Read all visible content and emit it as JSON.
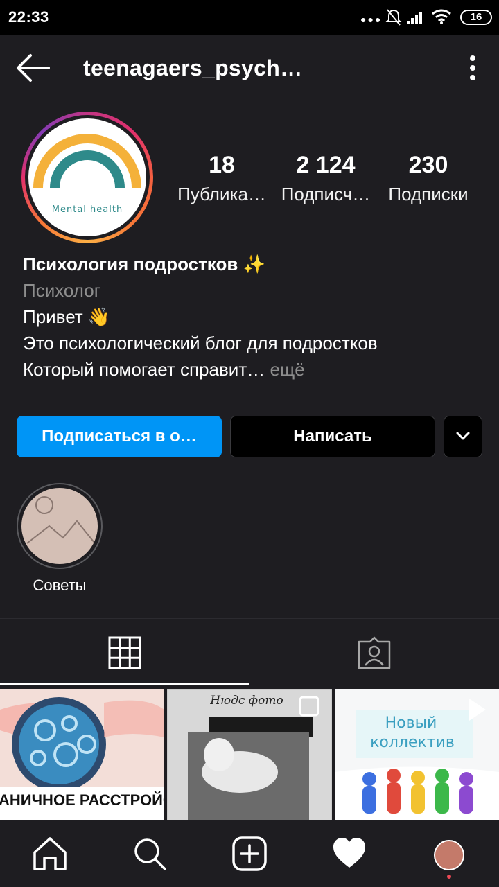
{
  "status_bar": {
    "time": "22:33",
    "battery": "16"
  },
  "header": {
    "username": "teenagaers_psych…"
  },
  "profile": {
    "avatar_text": "Mental health",
    "stats": [
      {
        "number": "18",
        "label": "Публика…"
      },
      {
        "number": "2 124",
        "label": "Подписч…"
      },
      {
        "number": "230",
        "label": "Подписки"
      }
    ],
    "name": "Психология  подростков ✨",
    "category": "Психолог",
    "bio_lines": [
      "Привет 👋",
      "Это психологический блог для подростков",
      "Который помогает справит…"
    ],
    "bio_more": " ещё"
  },
  "actions": {
    "follow_label": "Подписаться в о…",
    "message_label": "Написать"
  },
  "highlights": [
    {
      "label": "Советы"
    }
  ],
  "grid_posts": [
    {
      "caption": "ПОГРАНИЧНОЕ РАССТРОЙСТВО"
    },
    {
      "caption": "Нюдс фото"
    },
    {
      "caption_line1": "Новый",
      "caption_line2": "коллектив"
    }
  ],
  "colors": {
    "background": "#1e1d21",
    "accent": "#0095f6",
    "avatar_arc_orange": "#f4b13a",
    "avatar_arc_teal": "#2e8a8a"
  }
}
